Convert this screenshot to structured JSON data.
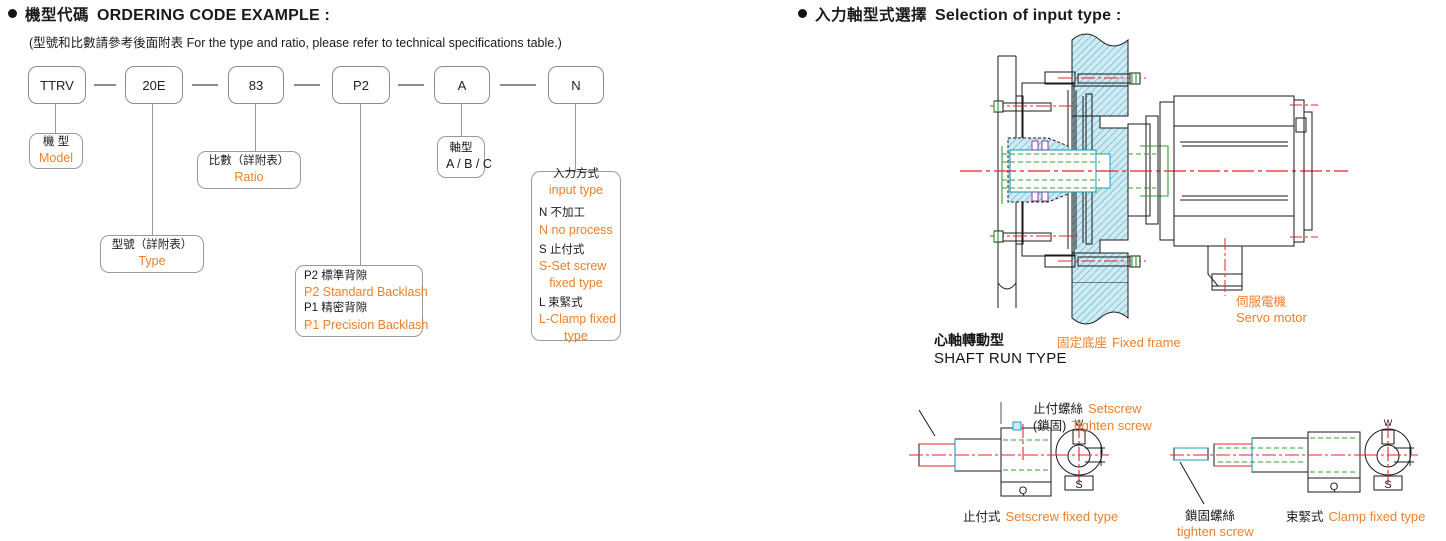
{
  "left_section": {
    "heading_cn": "機型代碼",
    "heading_en": "ORDERING CODE EXAMPLE :",
    "note": "(型號和比數請參考後面附表 For the type and ratio, please refer to technical specifications table.)",
    "code_boxes": [
      {
        "value": "TTRV"
      },
      {
        "value": "20E"
      },
      {
        "value": "83"
      },
      {
        "value": "P2"
      },
      {
        "value": "A"
      },
      {
        "value": "N"
      }
    ],
    "separator": "—",
    "callouts": {
      "model": {
        "cn": "機 型",
        "en": "Model"
      },
      "type": {
        "cn": "型號（詳附表）",
        "en": "Type"
      },
      "ratio": {
        "cn": "比數（詳附表）",
        "en": "Ratio"
      },
      "backlash": {
        "line1_cn": "P2 標準背隙",
        "line1_en": "P2 Standard Backlash",
        "line2_cn": "P1 精密背隙",
        "line2_en": "P1 Precision Backlash"
      },
      "shaft_type": {
        "cn": "軸型",
        "en": "A / B / C"
      },
      "input_type": {
        "title_cn": "入力方式",
        "title_en": "input type",
        "opt1_cn": "N 不加工",
        "opt1_en": "N no process",
        "opt2_cn": "S 止付式",
        "opt2_en": "S-Set screw",
        "opt2_en2": "fixed type",
        "opt3_cn": "L 束緊式",
        "opt3_en": "L-Clamp fixed",
        "opt3_en2": "type"
      }
    }
  },
  "right_section": {
    "heading_cn": "入力軸型式選擇",
    "heading_en": "Selection of input type :",
    "labels": {
      "shaft_run_cn": "心軸轉動型",
      "shaft_run_en": "SHAFT RUN TYPE",
      "fixed_frame_cn": "固定底座",
      "fixed_frame_en": "Fixed frame",
      "servo_motor_cn": "伺服電機",
      "servo_motor_en": "Servo motor",
      "setscrew_cn": "止付螺絲",
      "setscrew_en": "Setscrew",
      "tighten_cn": "(鎖固)",
      "tighten_en": "Tighten screw",
      "setscrew_fixed_cn": "止付式",
      "setscrew_fixed_en": "Setscrew fixed type",
      "lock_screw_cn": "鎖固螺絲",
      "lock_screw_en": "tighten screw",
      "clamp_fixed_cn": "束緊式",
      "clamp_fixed_en": "Clamp fixed type"
    },
    "dimensions": {
      "q": "Q",
      "s": "S",
      "w": "W"
    }
  },
  "colors": {
    "accent_orange": "#F07F28",
    "hatch_cyan": "#7FCBDC",
    "centerline_red": "#E8232A",
    "detail_green": "#2EA02E",
    "text_black": "#1a1a1a",
    "box_border": "#8c8c8c"
  }
}
